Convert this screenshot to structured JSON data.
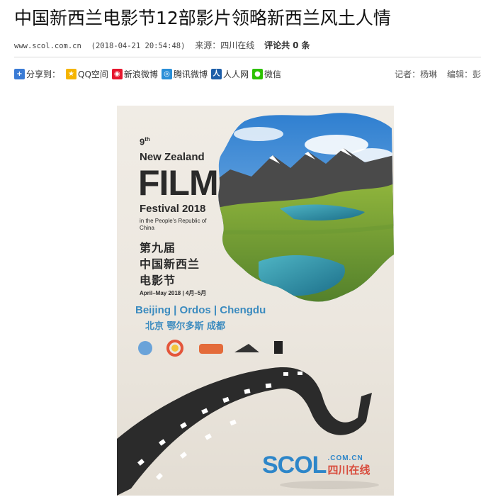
{
  "article": {
    "title": "中国新西兰电影节12部影片领略新西兰风土人情",
    "site_url": "www.scol.com.cn",
    "datetime": "(2018-04-21 20:54:48)",
    "source_label": "来源：",
    "source_name": "四川在线",
    "comment_prefix": "评论共",
    "comment_count": "0",
    "comment_suffix": "条"
  },
  "share": {
    "label": "分享到：",
    "items": [
      {
        "label": "QQ空间",
        "icon": "qzone-icon",
        "color": "#f5b400"
      },
      {
        "label": "新浪微博",
        "icon": "weibo-icon",
        "color": "#e6162d"
      },
      {
        "label": "腾讯微博",
        "icon": "tencent-weibo-icon",
        "color": "#2a8fd8"
      },
      {
        "label": "人人网",
        "icon": "renren-icon",
        "color": "#1d5ea8"
      },
      {
        "label": "微信",
        "icon": "wechat-icon",
        "color": "#2dc100"
      }
    ]
  },
  "byline": {
    "reporter": "记者：杨琳",
    "editor": "编辑：彭"
  },
  "poster": {
    "edition": "9",
    "edition_sup": "th",
    "subtitle": "New Zealand",
    "headline": "FILM",
    "festival": "Festival 2018",
    "prc": "in the People's Republic of China",
    "cn_line1": "第九届",
    "cn_line2": "中国新西兰",
    "cn_line3": "电影节",
    "dates": "April–May 2018 | 4月–5月",
    "cities_en": "Beijing | Ordos | Chengdu",
    "cities_cn": "北京 鄂尔多斯 成都",
    "watermark_scol": "SCOL",
    "watermark_domain": ".COM.CN",
    "watermark_cn": "四川在线"
  }
}
